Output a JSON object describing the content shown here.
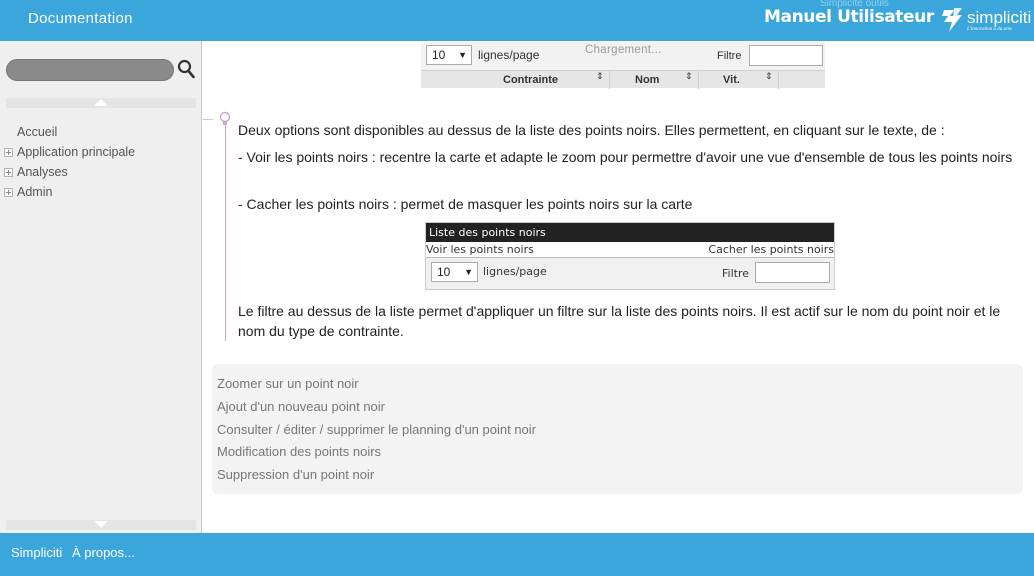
{
  "header": {
    "doc_title": "Documentation",
    "manual_title": "Manuel Utilisateur",
    "ghost_text": "Simplicité outils",
    "logo_name": "simpliciti",
    "logo_tagline": "L'innovation à du sens",
    "bg_color": "#3aa6dc"
  },
  "sidebar": {
    "search_placeholder": "",
    "items": [
      {
        "label": "Accueil",
        "expandable": false
      },
      {
        "label": "Application principale",
        "expandable": true
      },
      {
        "label": "Analyses",
        "expandable": true
      },
      {
        "label": "Admin",
        "expandable": true
      }
    ]
  },
  "content": {
    "shot1": {
      "page_size": "10",
      "lines_per_page": "lignes/page",
      "loading": "Chargement...",
      "filter_label": "Filtre",
      "columns": [
        "Contrainte",
        "Nom",
        "Vit."
      ]
    },
    "intro": "Deux options sont disponibles au dessus de la liste des points noirs. Elles permettent, en cliquant sur le texte, de :",
    "option1": "- Voir les points noirs : recentre la carte et adapte le zoom pour permettre d'avoir une vue d'ensemble de tous les points noirs",
    "option2": "- Cacher les points noirs : permet de masquer les points noirs sur la carte",
    "shot2": {
      "title": "Liste des points noirs",
      "show_link": "Voir les points noirs",
      "hide_link": "Cacher les points noirs",
      "page_size": "10",
      "lines_per_page": "lignes/page",
      "filter_label": "Filtre"
    },
    "filter_para": "Le filtre au dessus de la liste permet d'appliquer un filtre sur la liste des points noirs. Il est actif sur le nom du point noir et le nom du type de contrainte.",
    "related_links": [
      "Zoomer sur un point noir",
      "Ajout d'un nouveau point noir",
      "Consulter / éditer / supprimer le planning d'un point noir",
      "Modification des points noirs",
      "Suppression d'un point noir"
    ]
  },
  "footer": {
    "link1": "Simpliciti",
    "link2": "À propos..."
  }
}
